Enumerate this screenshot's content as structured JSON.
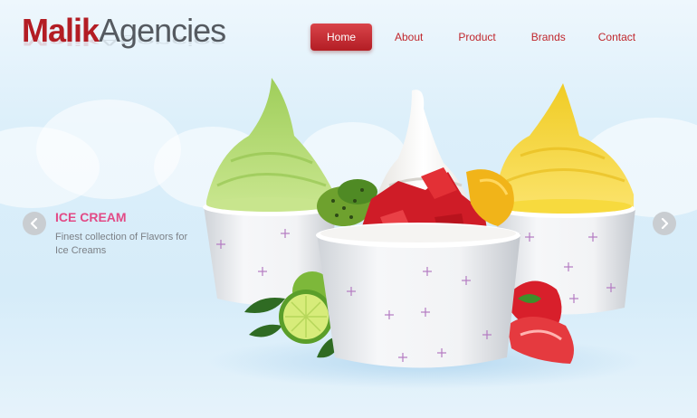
{
  "logo": {
    "part1": "Malik",
    "part2": "Agencies"
  },
  "nav": {
    "home": "Home",
    "about": "About",
    "product": "Product",
    "brands": "Brands",
    "contact": "Contact"
  },
  "slide": {
    "title": "ICE CREAM",
    "description": "Finest collection of Flavors for Ice Creams"
  },
  "icons": {
    "prev": "chevron-left-icon",
    "next": "chevron-right-icon"
  },
  "colors": {
    "brand_red": "#b31d24",
    "logo_gray": "#555a60",
    "slide_title_pink": "#e24a86",
    "background": "#dcefFa"
  }
}
